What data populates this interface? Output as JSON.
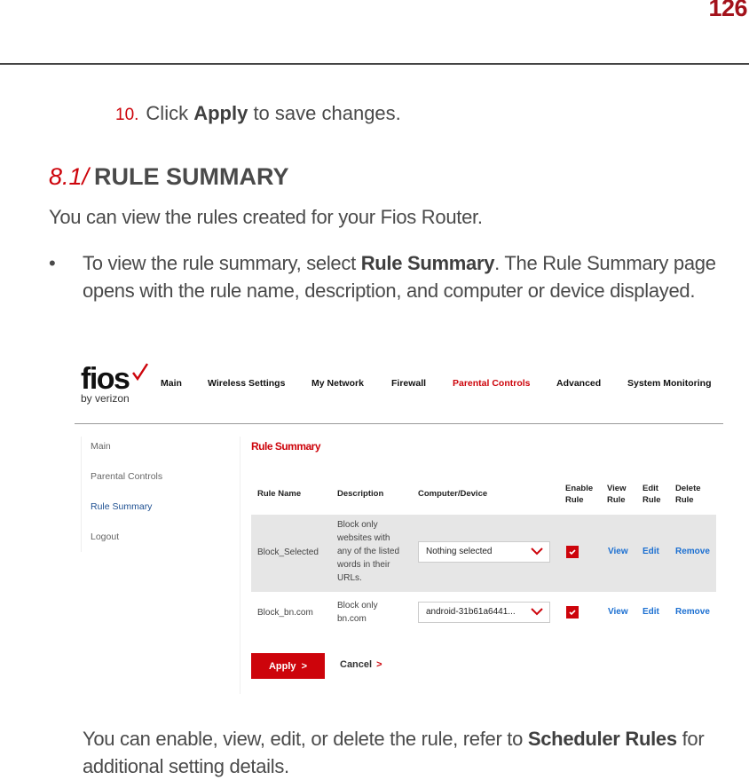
{
  "page": {
    "number": "126"
  },
  "step": {
    "number": "10.",
    "text_before": "Click ",
    "bold": "Apply",
    "text_after": " to save changes."
  },
  "section": {
    "number": "8.1/",
    "title": "RULE SUMMARY"
  },
  "intro": "You can view the rules created for your Fios Router.",
  "bullet": {
    "marker": "•",
    "text_before": "To view the rule summary, select ",
    "bold": "Rule Summary",
    "text_after": ". The Rule Summary page opens with the rule name, description, and computer or device displayed."
  },
  "outro": {
    "text_before": "You can enable, view, edit, or delete the rule, refer to ",
    "bold": "Scheduler Rules",
    "text_after": " for additional setting details."
  },
  "router_ui": {
    "logo": {
      "brand": "fios",
      "tagline": "by verizon"
    },
    "nav": [
      {
        "label": "Main",
        "active": false
      },
      {
        "label": "Wireless Settings",
        "active": false
      },
      {
        "label": "My Network",
        "active": false
      },
      {
        "label": "Firewall",
        "active": false
      },
      {
        "label": "Parental Controls",
        "active": true
      },
      {
        "label": "Advanced",
        "active": false
      },
      {
        "label": "System Monitoring",
        "active": false
      }
    ],
    "sidebar": [
      {
        "label": "Main",
        "active": false
      },
      {
        "label": "Parental Controls",
        "active": false
      },
      {
        "label": "Rule Summary",
        "active": true
      },
      {
        "label": "Logout",
        "active": false
      }
    ],
    "content_title": "Rule Summary",
    "table": {
      "headers": {
        "rule_name": "Rule Name",
        "description": "Description",
        "device": "Computer/Device",
        "enable": "Enable Rule",
        "view": "View Rule",
        "edit": "Edit Rule",
        "delete": "Delete Rule"
      },
      "rows": [
        {
          "rule_name": "Block_Selected",
          "description": "Block only websites with any of the listed words in their URLs.",
          "device": "Nothing selected",
          "enabled": true,
          "view": "View",
          "edit": "Edit",
          "remove": "Remove"
        },
        {
          "rule_name": "Block_bn.com",
          "description": "Block only bn.com",
          "device": "android-31b61a6441...",
          "enabled": true,
          "view": "View",
          "edit": "Edit",
          "remove": "Remove"
        }
      ]
    },
    "apply_label": "Apply",
    "cancel_label": "Cancel",
    "arrow_glyph": ">"
  },
  "colors": {
    "accent_red": "#cd040b",
    "page_number": "#a3121b",
    "link_blue": "#1b6fd1",
    "body_text": "#4a4a4a"
  }
}
